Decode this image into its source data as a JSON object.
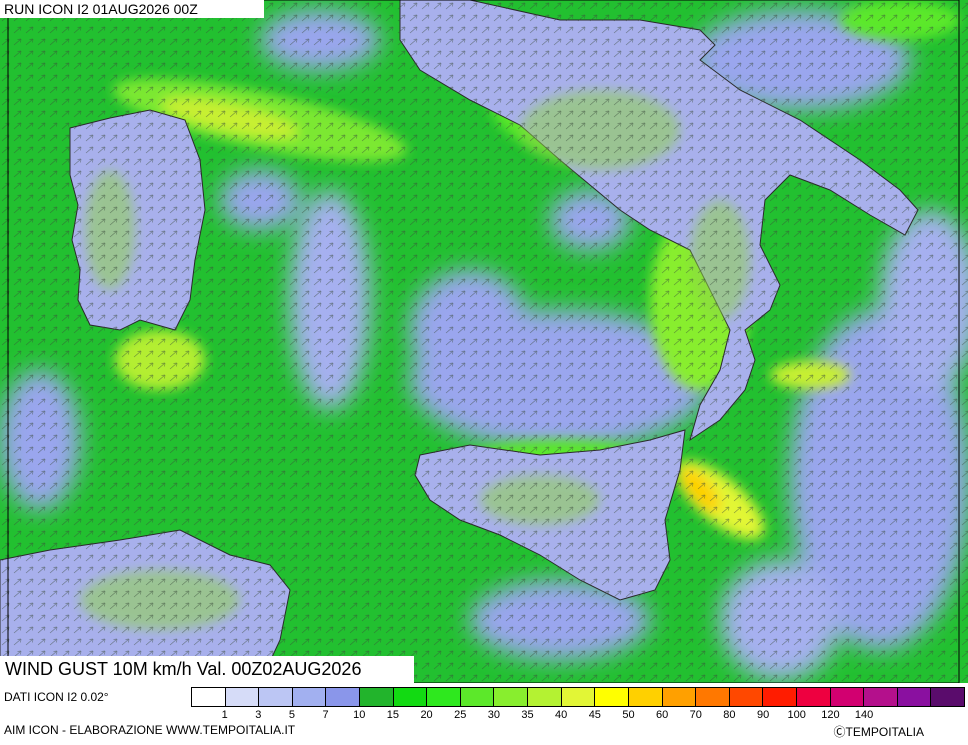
{
  "header": {
    "run_label": "RUN ICON I2 01AUG2026 00Z"
  },
  "map": {
    "title": "WIND GUST 10M km/h Val. 00Z02AUG2026",
    "regions": [
      "Sardinia",
      "Italian peninsula",
      "Sicily",
      "Calabria",
      "Tunisia coast",
      "Tyrrhenian Sea",
      "Ionian Sea"
    ]
  },
  "footer": {
    "data_source": "DATI ICON I2 0.02°",
    "elaboration": "AIM ICON - ELABORAZIONE WWW.TEMPOITALIA.IT",
    "copyright": "ⒸTEMPOITALIA"
  },
  "colorbar": {
    "colors": [
      "#ffffff",
      "#d6dcf8",
      "#bcc6f4",
      "#a2b0f0",
      "#8a96ea",
      "#22b42c",
      "#12da12",
      "#2ee81e",
      "#5ce82a",
      "#88ee2e",
      "#b4f232",
      "#e2f636",
      "#ffff00",
      "#ffd000",
      "#ffa000",
      "#ff7800",
      "#ff4800",
      "#ff1c00",
      "#ee0040",
      "#d20070",
      "#b4108c",
      "#8a10a0",
      "#5a0c6c"
    ],
    "tick_labels": [
      "1",
      "3",
      "5",
      "7",
      "10",
      "15",
      "20",
      "25",
      "30",
      "35",
      "40",
      "45",
      "50",
      "60",
      "70",
      "80",
      "90",
      "100",
      "120",
      "140"
    ]
  }
}
